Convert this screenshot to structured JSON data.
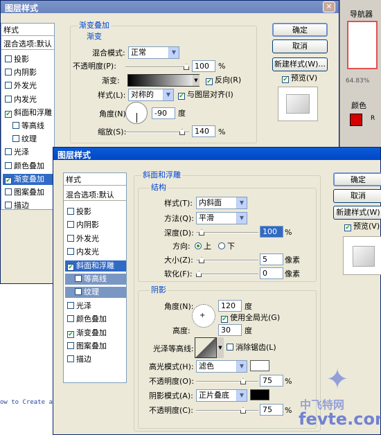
{
  "back_dialog": {
    "title": "图层样式",
    "styles_header": "样式",
    "blend_defaults": "混合选项:默认",
    "styles": [
      {
        "label": "投影",
        "checked": false
      },
      {
        "label": "内阴影",
        "checked": false
      },
      {
        "label": "外发光",
        "checked": false
      },
      {
        "label": "内发光",
        "checked": false
      },
      {
        "label": "斜面和浮雕",
        "checked": true
      },
      {
        "label": "等高线",
        "checked": false
      },
      {
        "label": "纹理",
        "checked": false
      },
      {
        "label": "光泽",
        "checked": false
      },
      {
        "label": "颜色叠加",
        "checked": false
      },
      {
        "label": "渐变叠加",
        "checked": true
      },
      {
        "label": "图案叠加",
        "checked": false
      },
      {
        "label": "描边",
        "checked": false
      }
    ],
    "group_title": "渐变叠加",
    "sub_title": "渐变",
    "blend_mode_label": "混合模式:",
    "blend_mode": "正常",
    "opacity_label": "不透明度(P):",
    "opacity": "100",
    "pct": "%",
    "gradient_label": "渐变:",
    "reverse_label": "反向(R)",
    "style_label": "样式(L):",
    "style_value": "对称的",
    "align_label": "与图层对齐(I)",
    "angle_label": "角度(N):",
    "angle": "-90",
    "degree": "度",
    "scale_label": "缩放(S):",
    "scale": "140",
    "ok": "确定",
    "cancel": "取消",
    "new_style": "新建样式(W)...",
    "preview": "预览(V)"
  },
  "navigator": {
    "title": "导航器",
    "zoom": "64.83%",
    "color_tab": "颜色",
    "color_r": "R"
  },
  "front_dialog": {
    "title": "图层样式",
    "styles_header": "样式",
    "blend_defaults": "混合选项:默认",
    "styles": [
      {
        "label": "投影",
        "checked": false
      },
      {
        "label": "内阴影",
        "checked": false
      },
      {
        "label": "外发光",
        "checked": false
      },
      {
        "label": "内发光",
        "checked": false
      },
      {
        "label": "斜面和浮雕",
        "checked": true
      },
      {
        "label": "等高线",
        "checked": false
      },
      {
        "label": "纹理",
        "checked": false
      },
      {
        "label": "光泽",
        "checked": false
      },
      {
        "label": "颜色叠加",
        "checked": false
      },
      {
        "label": "渐变叠加",
        "checked": true
      },
      {
        "label": "图案叠加",
        "checked": false
      },
      {
        "label": "描边",
        "checked": false
      }
    ],
    "group_title": "斜面和浮雕",
    "structure_title": "结构",
    "style_label": "样式(T):",
    "style_value": "内斜面",
    "method_label": "方法(Q):",
    "method_value": "平滑",
    "depth_label": "深度(D):",
    "depth": "100",
    "pct": "%",
    "direction_label": "方向:",
    "dir_up": "上",
    "dir_down": "下",
    "size_label": "大小(Z):",
    "size": "5",
    "pixels": "像素",
    "soften_label": "软化(F):",
    "soften": "0",
    "shading_title": "阴影",
    "angle_label": "角度(N):",
    "angle": "120",
    "degree": "度",
    "global_light": "使用全局光(G)",
    "altitude_label": "高度:",
    "altitude": "30",
    "gloss_label": "光泽等高线:",
    "antialias": "消除锯齿(L)",
    "highlight_label": "高光模式(H):",
    "highlight_mode": "滤色",
    "hl_opacity_label": "不透明度(O):",
    "hl_opacity": "75",
    "shadow_label": "阴影模式(A):",
    "shadow_mode": "正片叠底",
    "sh_opacity_label": "不透明度(C):",
    "sh_opacity": "75",
    "ok": "确定",
    "cancel": "取消",
    "new_style": "新建样式(W)",
    "preview": "预览(V)"
  },
  "background_text": "ow to Create a",
  "watermark": {
    "cn": "中飞特网",
    "url": "fevte.com"
  },
  "colors": {
    "selection": "#316ac5",
    "fg_swatch": "#d40000",
    "shadow_swatch": "#000000"
  }
}
